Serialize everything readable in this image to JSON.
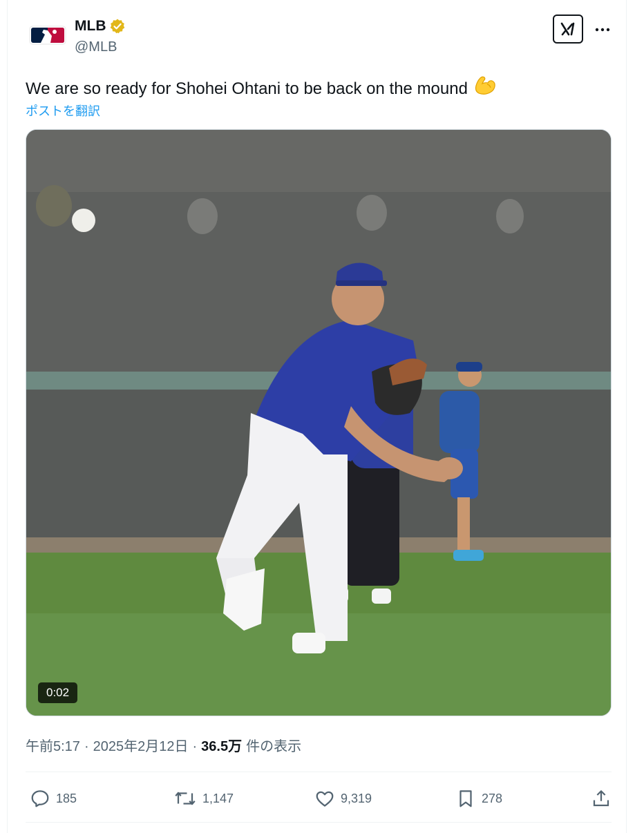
{
  "account": {
    "name": "MLB",
    "handle": "@MLB",
    "verified_badge": "verified-gold-icon",
    "avatar_icon": "mlb-logo-icon"
  },
  "header": {
    "grok_icon": "grok-icon",
    "more_icon": "more-icon"
  },
  "tweet": {
    "text": "We are so ready for Shohei Ohtani to be back on the mound",
    "emoji": "💪",
    "translate_label": "ポストを翻訳"
  },
  "media": {
    "type": "video",
    "duration": "0:02"
  },
  "meta": {
    "time": "午前5:17",
    "separator": "·",
    "date": "2025年2月12日",
    "views_count": "36.5万",
    "views_label": "件の表示"
  },
  "actions": {
    "replies": "185",
    "reposts": "1,147",
    "likes": "9,319",
    "bookmarks": "278"
  },
  "colors": {
    "link": "#1d9bf0",
    "secondary_text": "#536471",
    "verified_gold": "#e2b719"
  }
}
